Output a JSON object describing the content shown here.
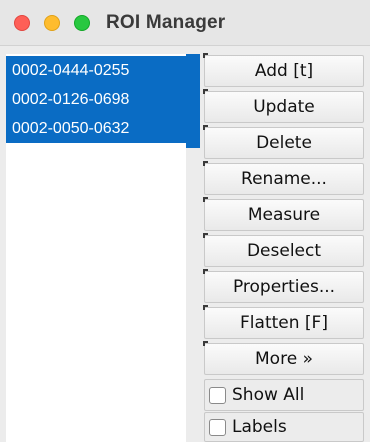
{
  "window": {
    "title": "ROI Manager"
  },
  "roi_list": {
    "items": [
      {
        "label": "0002-0444-0255",
        "selected": true
      },
      {
        "label": "0002-0126-0698",
        "selected": true
      },
      {
        "label": "0002-0050-0632",
        "selected": true
      }
    ]
  },
  "buttons": {
    "add": "Add [t]",
    "update": "Update",
    "delete": "Delete",
    "rename": "Rename...",
    "measure": "Measure",
    "deselect": "Deselect",
    "properties": "Properties...",
    "flatten": "Flatten [F]",
    "more": "More »"
  },
  "options": {
    "show_all": {
      "label": "Show All",
      "checked": false
    },
    "labels": {
      "label": "Labels",
      "checked": false
    }
  },
  "colors": {
    "selection": "#0a6cc4",
    "close": "#fe5f57",
    "minimize": "#febc2e",
    "zoom": "#28c840"
  }
}
